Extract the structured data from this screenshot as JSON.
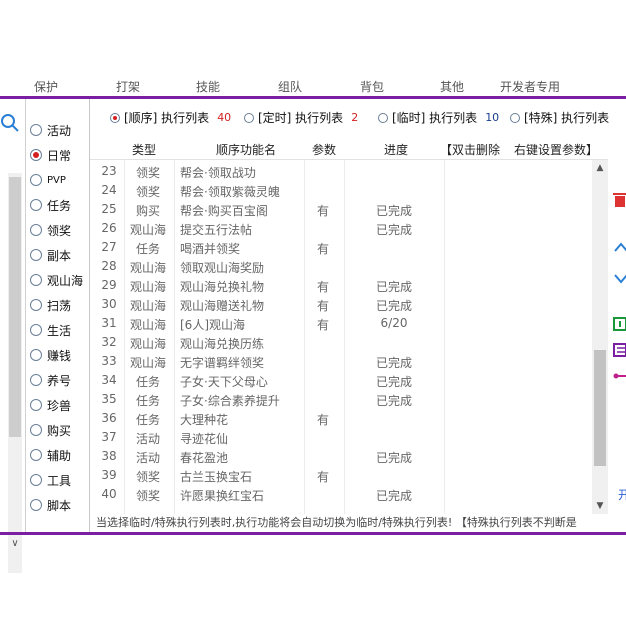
{
  "top_tabs": [
    "保护",
    "打架",
    "技能",
    "组队",
    "背包",
    "其他",
    "开发者专用"
  ],
  "nav": {
    "items": [
      {
        "label": "活动",
        "selected": false
      },
      {
        "label": "日常",
        "selected": true
      },
      {
        "label": "PVP",
        "selected": false
      },
      {
        "label": "任务",
        "selected": false
      },
      {
        "label": "领奖",
        "selected": false
      },
      {
        "label": "副本",
        "selected": false
      },
      {
        "label": "观山海",
        "selected": false
      },
      {
        "label": "扫荡",
        "selected": false
      },
      {
        "label": "生活",
        "selected": false
      },
      {
        "label": "赚钱",
        "selected": false
      },
      {
        "label": "养号",
        "selected": false
      },
      {
        "label": "珍兽",
        "selected": false
      },
      {
        "label": "购买",
        "selected": false
      },
      {
        "label": "辅助",
        "selected": false
      },
      {
        "label": "工具",
        "selected": false
      },
      {
        "label": "脚本",
        "selected": false
      }
    ]
  },
  "modes": [
    {
      "label": "[顺序] 执行列表",
      "count": "40",
      "selected": true
    },
    {
      "label": "[定时] 执行列表",
      "count": "2",
      "selected": false
    },
    {
      "label": "[临时] 执行列表",
      "count": "10",
      "selected": false
    },
    {
      "label": "[特殊] 执行列表",
      "count": "",
      "selected": false
    }
  ],
  "table": {
    "headers": [
      "类型",
      "顺序功能名",
      "参数",
      "进度",
      "【双击删除",
      "右键设置参数】"
    ],
    "rows": [
      {
        "idx": "23",
        "type": "领奖",
        "name": "帮会·领取战功",
        "param": "",
        "progress": ""
      },
      {
        "idx": "24",
        "type": "领奖",
        "name": "帮会·领取紫薇灵魄",
        "param": "",
        "progress": ""
      },
      {
        "idx": "25",
        "type": "购买",
        "name": "帮会·购买百宝阁",
        "param": "有",
        "progress": "已完成"
      },
      {
        "idx": "26",
        "type": "观山海",
        "name": "提交五行法帖",
        "param": "",
        "progress": "已完成"
      },
      {
        "idx": "27",
        "type": "任务",
        "name": "喝酒并领奖",
        "param": "有",
        "progress": ""
      },
      {
        "idx": "28",
        "type": "观山海",
        "name": "领取观山海奖励",
        "param": "",
        "progress": ""
      },
      {
        "idx": "29",
        "type": "观山海",
        "name": "观山海兑换礼物",
        "param": "有",
        "progress": "已完成"
      },
      {
        "idx": "30",
        "type": "观山海",
        "name": "观山海赠送礼物",
        "param": "有",
        "progress": "已完成"
      },
      {
        "idx": "31",
        "type": "观山海",
        "name": "[6人]观山海",
        "param": "有",
        "progress": "6/20"
      },
      {
        "idx": "32",
        "type": "观山海",
        "name": "观山海兑换历练",
        "param": "",
        "progress": ""
      },
      {
        "idx": "33",
        "type": "观山海",
        "name": "无字谱羁绊领奖",
        "param": "",
        "progress": "已完成"
      },
      {
        "idx": "34",
        "type": "任务",
        "name": "子女·天下父母心",
        "param": "",
        "progress": "已完成"
      },
      {
        "idx": "35",
        "type": "任务",
        "name": "子女·综合素养提升",
        "param": "",
        "progress": "已完成"
      },
      {
        "idx": "36",
        "type": "任务",
        "name": "大理种花",
        "param": "有",
        "progress": ""
      },
      {
        "idx": "37",
        "type": "活动",
        "name": "寻迹花仙",
        "param": "",
        "progress": ""
      },
      {
        "idx": "38",
        "type": "活动",
        "name": "春花盈池",
        "param": "",
        "progress": "已完成"
      },
      {
        "idx": "39",
        "type": "领奖",
        "name": "古兰玉换宝石",
        "param": "有",
        "progress": ""
      },
      {
        "idx": "40",
        "type": "领奖",
        "name": "许愿果换红宝石",
        "param": "",
        "progress": "已完成"
      }
    ]
  },
  "right_strip_text": "开",
  "status_text": "当选择临时/特殊执行列表时,执行功能将会自动切换为临时/特殊执行列表! 【特殊执行列表不判断是",
  "colors": {
    "accent": "#7a1fa2",
    "radio_on": "#d42020",
    "count_blue": "#1a3d8f"
  }
}
